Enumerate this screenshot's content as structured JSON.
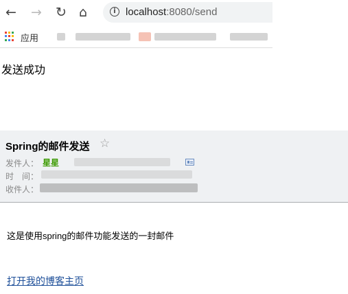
{
  "browser": {
    "nav": {
      "back_icon": "arrow-left-icon",
      "forward_icon": "arrow-right-icon",
      "reload_icon": "reload-icon",
      "home_icon": "home-icon"
    },
    "info_icon": "info-circle-icon",
    "url_host": "localhost",
    "url_rest": ":8080/send",
    "bookmarks": {
      "apps_label": "应用",
      "apps_colors": [
        "#ea4335",
        "#fbbc05",
        "#34a853",
        "#4285f4",
        "#ea4335",
        "#fbbc05",
        "#34a853",
        "#4285f4",
        "#ea4335"
      ]
    }
  },
  "page": {
    "result_text": "发送成功"
  },
  "mail": {
    "subject": "Spring的邮件发送",
    "star_icon": "star-outline-icon",
    "from_label": "发件人：",
    "from_name": "星星",
    "time_label": "时　间：",
    "to_label": "收件人：",
    "card_icon": "contact-card-icon",
    "body": "这是使用spring的邮件功能发送的一封邮件",
    "link_text": "打开我的博客主页"
  }
}
